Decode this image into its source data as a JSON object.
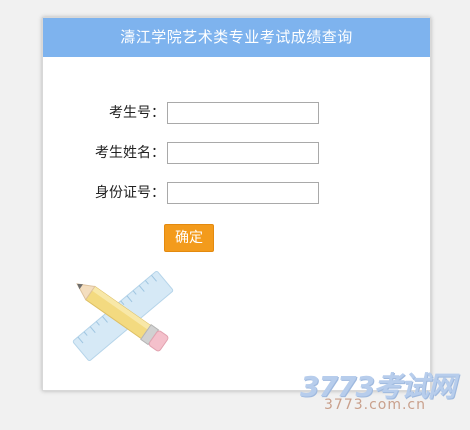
{
  "header": {
    "title": "濤江学院艺术类专业考试成绩查询"
  },
  "form": {
    "fields": [
      {
        "label": "考生号：",
        "value": ""
      },
      {
        "label": "考生姓名：",
        "value": ""
      },
      {
        "label": "身份证号：",
        "value": ""
      }
    ],
    "submit_label": "确定"
  },
  "watermark": {
    "main": "3773考试网",
    "sub": "3773.com.cn"
  },
  "colors": {
    "header_bg": "#7eb3ee",
    "button_bg": "#f39b1c"
  },
  "icons": {
    "decoration": "pencil-ruler-icon"
  }
}
